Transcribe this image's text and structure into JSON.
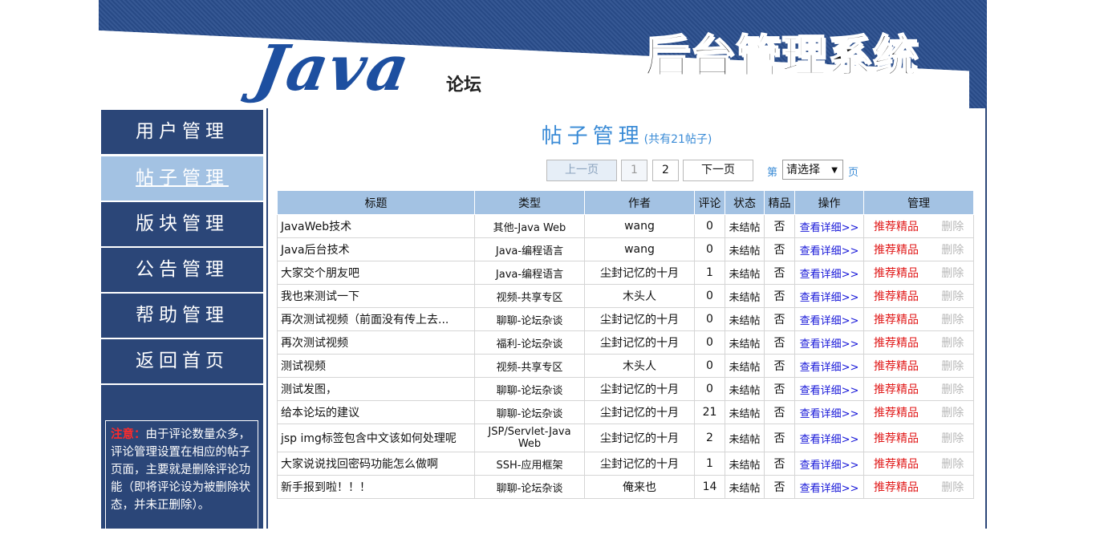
{
  "header": {
    "logo_text": "Java",
    "logo_sub": "论坛",
    "system_title": "后台管理系统"
  },
  "sidebar": {
    "items": [
      {
        "label": "用户管理",
        "active": false
      },
      {
        "label": "帖子管理",
        "active": true
      },
      {
        "label": "版块管理",
        "active": false
      },
      {
        "label": "公告管理",
        "active": false
      },
      {
        "label": "帮助管理",
        "active": false
      },
      {
        "label": "返回首页",
        "active": false
      }
    ],
    "notice": {
      "label": "注意：",
      "text": "由于评论数量众多，评论管理设置在相应的帖子页面，主要就是删除评论功能（即将评论设为被删除状态，并未正删除）。"
    }
  },
  "main": {
    "title": "帖子管理",
    "count_text": "(共有21帖子)",
    "pager": {
      "prev": "上一页",
      "pages": [
        "1",
        "2"
      ],
      "next": "下一页",
      "prefix": "第",
      "select_value": "请选择",
      "suffix": "页"
    },
    "columns": [
      "标题",
      "类型",
      "作者",
      "评论",
      "状态",
      "精品",
      "操作",
      "管理"
    ],
    "rows": [
      {
        "title": "JavaWeb技术",
        "type": "其他-Java Web",
        "author": "wang",
        "comments": "0",
        "status": "未结帖",
        "featured": "否",
        "action": "查看详细>>",
        "recommend": "推荐精品",
        "delete": "删除"
      },
      {
        "title": "Java后台技术",
        "type": "Java-编程语言",
        "author": "wang",
        "comments": "0",
        "status": "未结帖",
        "featured": "否",
        "action": "查看详细>>",
        "recommend": "推荐精品",
        "delete": "删除"
      },
      {
        "title": "大家交个朋友吧",
        "type": "Java-编程语言",
        "author": "尘封记忆的十月",
        "comments": "1",
        "status": "未结帖",
        "featured": "否",
        "action": "查看详细>>",
        "recommend": "推荐精品",
        "delete": "删除"
      },
      {
        "title": "我也来测试一下",
        "type": "视频-共享专区",
        "author": "木头人",
        "comments": "0",
        "status": "未结帖",
        "featured": "否",
        "action": "查看详细>>",
        "recommend": "推荐精品",
        "delete": "删除"
      },
      {
        "title": "再次测试视频（前面没有传上去...",
        "type": "聊聊-论坛杂谈",
        "author": "尘封记忆的十月",
        "comments": "0",
        "status": "未结帖",
        "featured": "否",
        "action": "查看详细>>",
        "recommend": "推荐精品",
        "delete": "删除"
      },
      {
        "title": "再次测试视频",
        "type": "福利-论坛杂谈",
        "author": "尘封记忆的十月",
        "comments": "0",
        "status": "未结帖",
        "featured": "否",
        "action": "查看详细>>",
        "recommend": "推荐精品",
        "delete": "删除"
      },
      {
        "title": "测试视频",
        "type": "视频-共享专区",
        "author": "木头人",
        "comments": "0",
        "status": "未结帖",
        "featured": "否",
        "action": "查看详细>>",
        "recommend": "推荐精品",
        "delete": "删除"
      },
      {
        "title": "测试发图，",
        "type": "聊聊-论坛杂谈",
        "author": "尘封记忆的十月",
        "comments": "0",
        "status": "未结帖",
        "featured": "否",
        "action": "查看详细>>",
        "recommend": "推荐精品",
        "delete": "删除"
      },
      {
        "title": "给本论坛的建议",
        "type": "聊聊-论坛杂谈",
        "author": "尘封记忆的十月",
        "comments": "21",
        "status": "未结帖",
        "featured": "否",
        "action": "查看详细>>",
        "recommend": "推荐精品",
        "delete": "删除"
      },
      {
        "title": "jsp img标签包含中文该如何处理呢",
        "type": "JSP/Servlet-Java Web",
        "author": "尘封记忆的十月",
        "comments": "2",
        "status": "未结帖",
        "featured": "否",
        "action": "查看详细>>",
        "recommend": "推荐精品",
        "delete": "删除"
      },
      {
        "title": "大家说说找回密码功能怎么做啊",
        "type": "SSH-应用框架",
        "author": "尘封记忆的十月",
        "comments": "1",
        "status": "未结帖",
        "featured": "否",
        "action": "查看详细>>",
        "recommend": "推荐精品",
        "delete": "删除"
      },
      {
        "title": "新手报到啦！！！",
        "type": "聊聊-论坛杂谈",
        "author": "俺来也",
        "comments": "14",
        "status": "未结帖",
        "featured": "否",
        "action": "查看详细>>",
        "recommend": "推荐精品",
        "delete": "删除"
      }
    ]
  },
  "colors": {
    "header_blue": "#2b4f8e",
    "sidebar_blue": "#2b4678",
    "active_item": "#a3c2e3",
    "title_blue": "#3a8bd6",
    "link_blue": "#1616d8",
    "recommend_red": "#e01818"
  }
}
